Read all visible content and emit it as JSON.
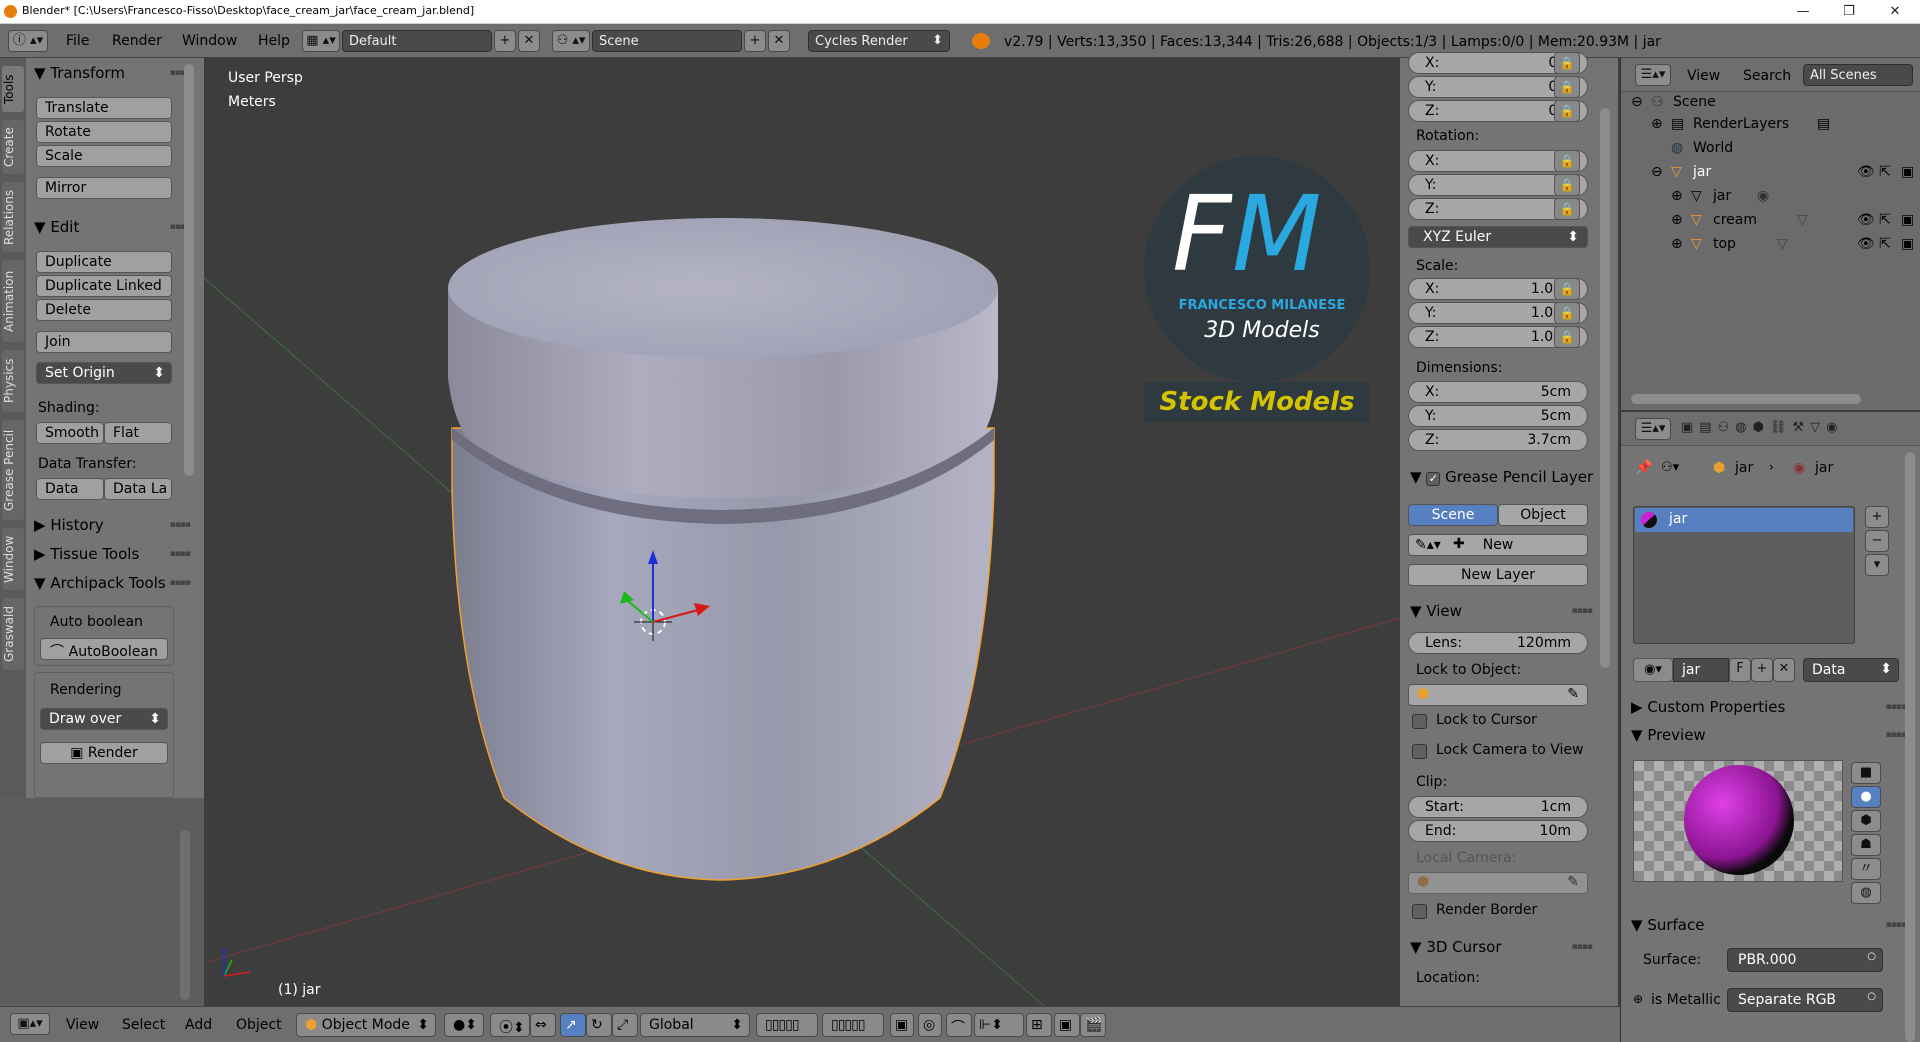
{
  "window": {
    "title": "Blender* [C:\\Users\\Francesco-Fisso\\Desktop\\face_cream_jar\\face_cream_jar.blend]",
    "minimize": "—",
    "maximize": "❐",
    "close": "✕"
  },
  "topbar": {
    "menus": [
      "File",
      "Render",
      "Window",
      "Help"
    ],
    "layout": "Default",
    "scene": "Scene",
    "engine": "Cycles Render",
    "info": "v2.79 | Verts:13,350 | Faces:13,344 | Tris:26,688 | Objects:1/3 | Lamps:0/0 | Mem:20.93M | jar"
  },
  "tabs": [
    "Tools",
    "Create",
    "Relations",
    "Animation",
    "Physics",
    "Grease Pencil",
    "Window",
    "Graswald"
  ],
  "toolshelf": {
    "transform": {
      "header": "Transform",
      "buttons": [
        "Translate",
        "Rotate",
        "Scale",
        "Mirror"
      ]
    },
    "edit": {
      "header": "Edit",
      "buttons": [
        "Duplicate",
        "Duplicate Linked",
        "Delete",
        "Join",
        "Set Origin"
      ],
      "shading_label": "Shading:",
      "smooth": "Smooth",
      "flat": "Flat",
      "data_transfer_label": "Data Transfer:",
      "data": "Data",
      "data_la": "Data La"
    },
    "history": "History",
    "tissue": "Tissue Tools",
    "archipack": "Archipack Tools",
    "auto_boolean_label": "Auto boolean",
    "auto_boolean_btn": "AutoBoolean",
    "rendering_label": "Rendering",
    "draw_over": "Draw over",
    "render_btn": "Render"
  },
  "viewport": {
    "view_name": "User Persp",
    "units": "Meters",
    "selected": "(1) jar",
    "logo": {
      "letters": "FM",
      "name": "FRANCESCO MILANESE",
      "subtitle": "3D Models",
      "banner": "Stock Models"
    }
  },
  "npanel": {
    "location": {
      "x": "0m",
      "y": "0m",
      "z": "0m"
    },
    "rotation_label": "Rotation:",
    "rotation": {
      "x": "0°",
      "y": "0°",
      "z": "0°"
    },
    "rotation_mode": "XYZ Euler",
    "scale_label": "Scale:",
    "scale": {
      "x": "1.000",
      "y": "1.000",
      "z": "1.000"
    },
    "dimensions_label": "Dimensions:",
    "dimensions": {
      "x": "5cm",
      "y": "5cm",
      "z": "3.7cm"
    },
    "axis": {
      "x": "X:",
      "y": "Y:",
      "z": "Z:"
    },
    "grease_pencil": {
      "header": "Grease Pencil Layer",
      "scene": "Scene",
      "object": "Object",
      "new": "New",
      "new_layer": "New Layer"
    },
    "view": {
      "header": "View",
      "lens_label": "Lens:",
      "lens": "120mm",
      "lock_to_object": "Lock to Object:",
      "lock_to_cursor": "Lock to Cursor",
      "lock_camera": "Lock Camera to View",
      "clip": "Clip:",
      "start_label": "Start:",
      "start": "1cm",
      "end_label": "End:",
      "end": "10m",
      "local_camera": "Local Camera:",
      "render_border": "Render Border"
    },
    "cursor": {
      "header": "3D Cursor",
      "location": "Location:"
    }
  },
  "outliner": {
    "view": "View",
    "search": "Search",
    "filter": "All Scenes",
    "rows": [
      "Scene",
      "RenderLayers",
      "World",
      "jar",
      "jar",
      "cream",
      "top"
    ]
  },
  "properties": {
    "breadcrumb_obj": "jar",
    "breadcrumb_mat": "jar",
    "material_slot": "jar",
    "mat_name": "jar",
    "mat_f": "F",
    "data_select": "Data",
    "custom_props": "Custom Properties",
    "preview": "Preview",
    "surface_header": "Surface",
    "surface_label": "Surface:",
    "surface_value": "PBR.000",
    "is_metallic": "is Metallic",
    "is_metallic_value": "Separate RGB"
  },
  "bottombar": {
    "menus": [
      "View",
      "Select",
      "Add",
      "Object"
    ],
    "mode": "Object Mode",
    "orientation": "Global"
  },
  "colors": {
    "selected_blue": "#5680c2",
    "outline_orange": "#f0a030",
    "logo_bg": "#2f3a40",
    "logo_blue": "#2aa8e0",
    "logo_yellow": "#d4c400"
  }
}
